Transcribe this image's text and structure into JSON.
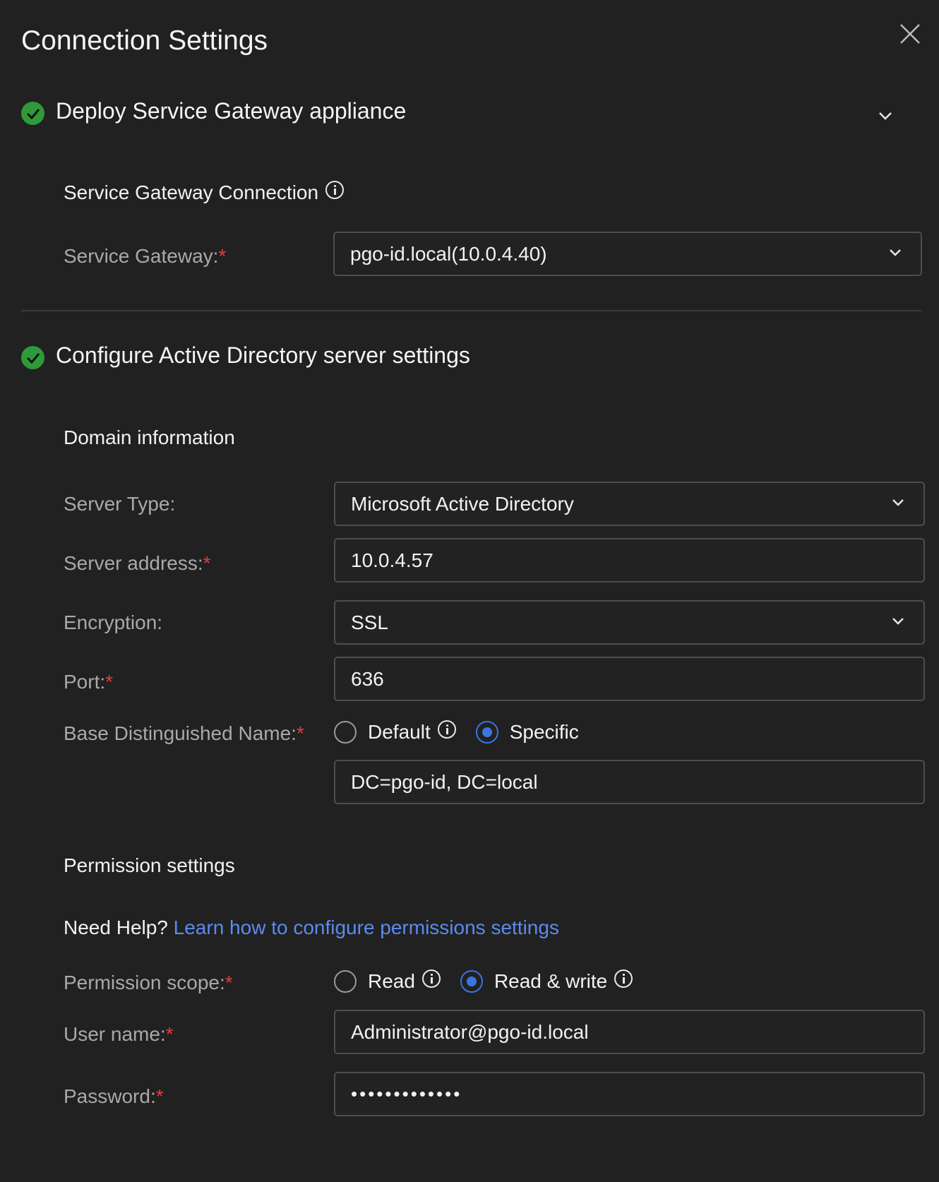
{
  "dialog": {
    "title": "Connection Settings"
  },
  "step1": {
    "title": "Deploy Service Gateway appliance",
    "status": "complete",
    "subsection_title": "Service Gateway Connection",
    "gateway_label": "Service Gateway:",
    "gateway_value": "pgo-id.local(10.0.4.40)"
  },
  "step2": {
    "title": "Configure Active Directory server settings",
    "status": "complete",
    "domain_info_title": "Domain information",
    "server_type_label": "Server Type:",
    "server_type_value": "Microsoft Active Directory",
    "server_address_label": "Server address:",
    "server_address_value": "10.0.4.57",
    "encryption_label": "Encryption:",
    "encryption_value": "SSL",
    "port_label": "Port:",
    "port_value": "636",
    "base_dn_label": "Base Distinguished Name:",
    "base_dn_options": [
      "Default",
      "Specific"
    ],
    "base_dn_selected": "Specific",
    "base_dn_value": "DC=pgo-id, DC=local",
    "permission_title": "Permission settings",
    "help_prefix": "Need Help?",
    "help_link": "Learn how to configure permissions settings",
    "permission_scope_label": "Permission scope:",
    "permission_options": [
      "Read",
      "Read & write"
    ],
    "permission_selected": "Read & write",
    "username_label": "User name:",
    "username_value": "Administrator@pgo-id.local",
    "password_label": "Password:",
    "password_mask": "•••••••••••••"
  },
  "required_marker": "*",
  "colors": {
    "background": "#212121",
    "success": "#2e9a3a",
    "accent": "#3b74e3",
    "link": "#5b8bef",
    "required": "#e0403a"
  },
  "icons": {
    "close": "close-icon",
    "check": "check-circle-icon",
    "chevron": "chevron-down-icon",
    "info": "info-icon"
  }
}
